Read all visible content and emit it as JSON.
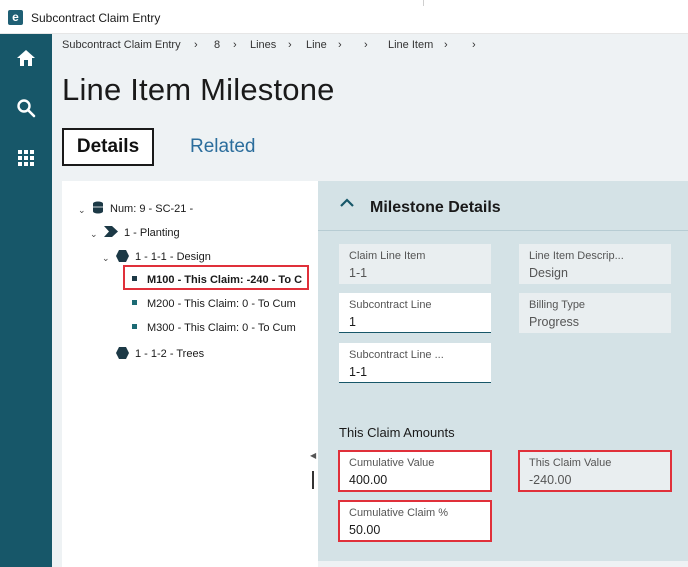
{
  "window": {
    "title": "Subcontract Claim Entry",
    "logo_letter": "e"
  },
  "rail": {
    "items": [
      "home-icon",
      "search-icon",
      "grid-icon"
    ]
  },
  "breadcrumb": {
    "items": [
      "Subcontract Claim Entry",
      "8",
      "Lines",
      "Line",
      "",
      "Line Item",
      ""
    ],
    "separator": "›"
  },
  "page": {
    "title": "Line Item Milestone"
  },
  "tabs": {
    "details": "Details",
    "related": "Related"
  },
  "tree": {
    "root": "Num: 9 - SC-21 -",
    "planting": "1 - Planting",
    "design": "1 - 1-1 - Design",
    "m100": "M100 - This Claim: -240 - To C",
    "m200": "M200 - This Claim: 0 - To Cum",
    "m300": "M300 - This Claim: 0 - To Cum",
    "trees": "1 - 1-2 - Trees"
  },
  "panel": {
    "title": "Milestone Details",
    "fields": {
      "claim_line_item": {
        "label": "Claim Line Item",
        "value": "1-1"
      },
      "line_item_description": {
        "label": "Line Item Descrip...",
        "value": "Design"
      },
      "subcontract_line": {
        "label": "Subcontract Line",
        "value": "1"
      },
      "billing_type": {
        "label": "Billing Type",
        "value": "Progress"
      },
      "subcontract_line_item": {
        "label": "Subcontract Line ...",
        "value": "1-1"
      }
    },
    "amounts": {
      "section_title": "This Claim Amounts",
      "cumulative_value": {
        "label": "Cumulative Value",
        "value": "400.00"
      },
      "this_claim_value": {
        "label": "This Claim Value",
        "value": "-240.00"
      },
      "cumulative_claim_pct": {
        "label": "Cumulative Claim %",
        "value": "50.00"
      }
    }
  },
  "colors": {
    "rail": "#175769",
    "highlight": "#e0303a",
    "panel": "#d4e2e6",
    "link": "#2b6d9c"
  }
}
